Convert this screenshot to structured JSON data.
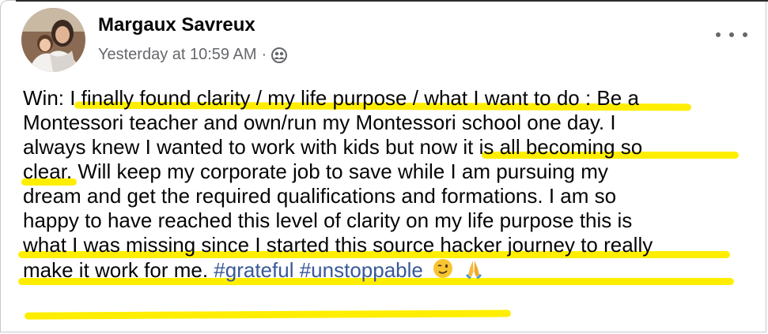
{
  "post": {
    "author": "Margaux Savreux",
    "timestamp": "Yesterday at 10:59 AM",
    "separator": "·",
    "audience_icon": "friends-icon",
    "more_icon": "more-options-icon",
    "lines": [
      "Win: I finally found clarity / my life purpose / what I want to do : Be a",
      "Montessori teacher and own/run my Montessori school one day. I",
      "always knew I wanted to work with kids but now it is all becoming so",
      "clear. Will keep my corporate job to save while I am pursuing my",
      "dream and get the required qualifications and formations. I am so",
      "happy to have reached this level of clarity on my life purpose this is",
      "what I was missing since I started this source hacker journey to really"
    ],
    "last_line_text": "make it work for me.",
    "hashtags": [
      "#grateful",
      "#unstoppable"
    ],
    "emojis": [
      "winking-face-icon",
      "folded-hands-icon"
    ]
  },
  "colors": {
    "highlight": "#ffee00",
    "hashtag": "#385898",
    "meta": "#65676b"
  }
}
